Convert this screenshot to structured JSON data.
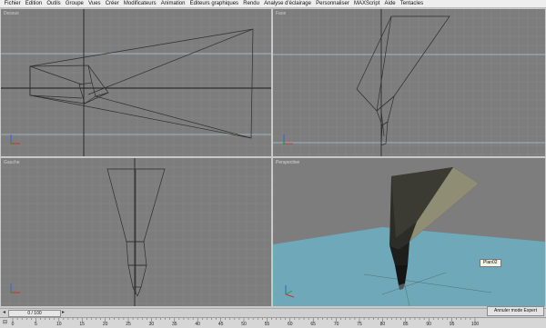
{
  "menu": [
    "Fichier",
    "Edition",
    "Outils",
    "Groupe",
    "Vues",
    "Créer",
    "Modificateurs",
    "Animation",
    "Editeurs graphiques",
    "Rendu",
    "Analyse d'éclairage",
    "Personnaliser",
    "MAXScript",
    "Aide",
    "Tentacles"
  ],
  "viewports": {
    "top": {
      "label": "Dessus"
    },
    "front": {
      "label": "Face"
    },
    "left": {
      "label": "Gauche"
    },
    "perspective": {
      "label": "Perspective",
      "object_label": "Plan02",
      "active": true
    }
  },
  "timeline": {
    "frame_display": "0 / 100",
    "prev_icon": "chevron-left-icon",
    "next_icon": "chevron-right-icon"
  },
  "ruler": {
    "labels": [
      "0",
      "5",
      "10",
      "15",
      "20",
      "25",
      "30",
      "35",
      "40",
      "45",
      "50",
      "55",
      "60",
      "65",
      "70",
      "75",
      "80",
      "85",
      "90",
      "95",
      "100"
    ]
  },
  "status": {
    "button_label": "Annuler mode Expert"
  },
  "colors": {
    "viewport_bg": "#7d7d7d",
    "grid": "#8a8a8a",
    "active_border": "#e3df92",
    "perspective_floor": "#6fa9b9",
    "wire": "#2e2e2e"
  }
}
